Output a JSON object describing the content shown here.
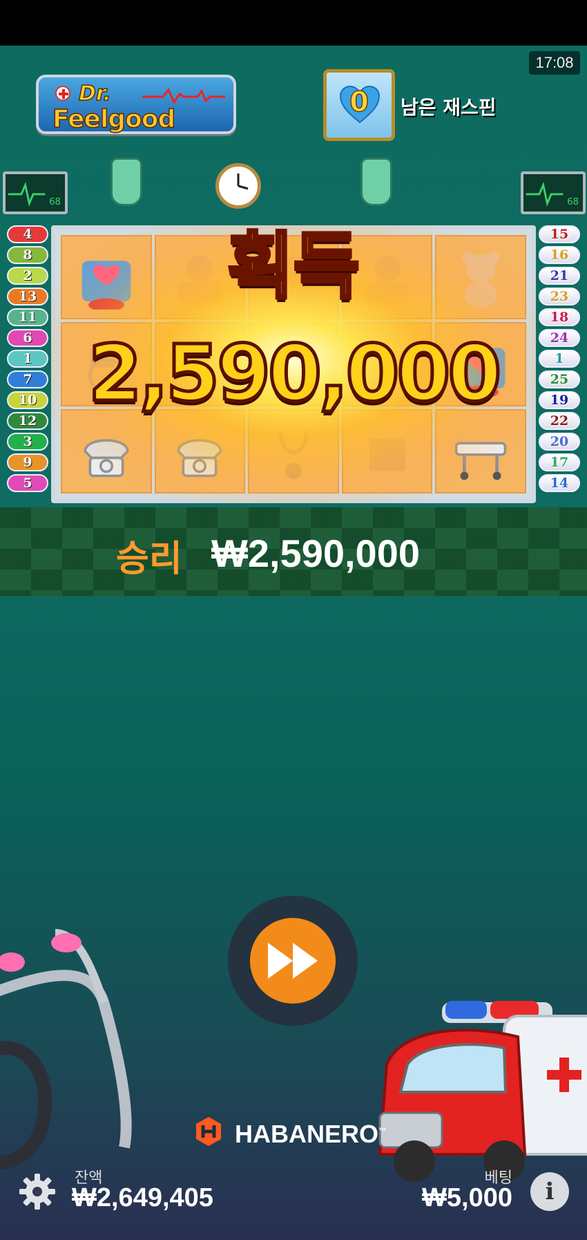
{
  "status": {
    "time": "17:08"
  },
  "logo": {
    "line1": "Dr.",
    "line2": "Feelgood"
  },
  "respin": {
    "count": "0",
    "label": "남은 재스핀"
  },
  "reels": {
    "rows": [
      [
        "heart-machine-icon",
        "patient-icon",
        "patient-icon",
        "patient-icon",
        "teddy-bear-icon"
      ],
      [
        "wheelchair-icon",
        "tray-icon",
        "stethoscope-icon",
        "box-icon",
        "heart-machine-icon"
      ],
      [
        "telephone-icon",
        "telephone-icon",
        "stethoscope-icon",
        "box-icon",
        "stretcher-icon"
      ]
    ]
  },
  "win_popup": {
    "title": "획득",
    "amount": "2,590,000"
  },
  "paylines": {
    "left": [
      "4",
      "8",
      "2",
      "13",
      "11",
      "6",
      "1",
      "7",
      "10",
      "12",
      "3",
      "9",
      "5"
    ],
    "right": [
      "15",
      "16",
      "21",
      "23",
      "18",
      "24",
      "1",
      "25",
      "19",
      "22",
      "20",
      "17",
      "14"
    ],
    "left_colors": [
      "#e53a3a",
      "#86b83a",
      "#b7d94a",
      "#e97a24",
      "#57b48a",
      "#e04ab0",
      "#5bc6c2",
      "#2f7fd8",
      "#c9d43a",
      "#2e8a3a",
      "#22b04a",
      "#e8932a",
      "#e04ab8"
    ],
    "right_text_colors": [
      "#c81e1e",
      "#d8a020",
      "#3a3aa8",
      "#d8a020",
      "#c81e4a",
      "#a030b0",
      "#1e9e9e",
      "#2e8a3a",
      "#1e1e9a",
      "#8a1e1e",
      "#4a6ad0",
      "#2eaa5a",
      "#2a6ad0"
    ]
  },
  "win_bar": {
    "label": "승리",
    "value": "₩2,590,000"
  },
  "spin_button": {
    "icon": "fast-forward-icon"
  },
  "brand": {
    "name": "HABANERO",
    "tm": "™"
  },
  "footer": {
    "balance_label": "잔액",
    "balance_value": "₩2,649,405",
    "bet_label": "베팅",
    "bet_value": "₩5,000",
    "info_symbol": "i"
  }
}
